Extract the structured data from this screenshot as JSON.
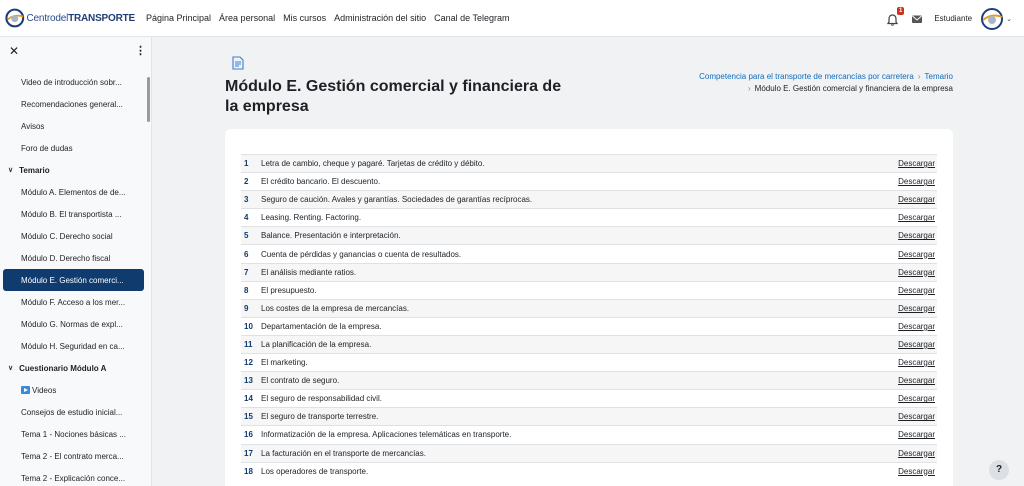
{
  "brand": {
    "text_light": "Centrodel",
    "text_bold": "TRANSPORTE"
  },
  "nav": {
    "links": [
      "Página Principal",
      "Área personal",
      "Mis cursos",
      "Administración del sitio",
      "Canal de Telegram"
    ],
    "notification_count": "1",
    "user_name": "Estudiante"
  },
  "drawer": {
    "items": [
      {
        "label": "Video de introducción sobr...",
        "type": "item"
      },
      {
        "label": "Recomendaciones general...",
        "type": "item"
      },
      {
        "label": "Avisos",
        "type": "item"
      },
      {
        "label": "Foro de dudas",
        "type": "item"
      },
      {
        "label": "Temario",
        "type": "section"
      },
      {
        "label": "Módulo A. Elementos de de...",
        "type": "item"
      },
      {
        "label": "Módulo B. El transportista ...",
        "type": "item"
      },
      {
        "label": "Módulo C. Derecho social",
        "type": "item"
      },
      {
        "label": "Módulo D. Derecho fiscal",
        "type": "item"
      },
      {
        "label": "Módulo E. Gestión comerci...",
        "type": "active"
      },
      {
        "label": "Módulo F. Acceso a los mer...",
        "type": "item"
      },
      {
        "label": "Módulo G. Normas de expl...",
        "type": "item"
      },
      {
        "label": "Módulo H. Seguridad en ca...",
        "type": "item"
      },
      {
        "label": "Cuestionario Módulo A",
        "type": "section"
      },
      {
        "label": "Videos",
        "type": "video"
      },
      {
        "label": "Consejos de estudio inicial...",
        "type": "item"
      },
      {
        "label": "Tema 1 - Nociones básicas ...",
        "type": "item"
      },
      {
        "label": "Tema 2 - El contrato merca...",
        "type": "item"
      },
      {
        "label": "Tema 2 - Explicación conce...",
        "type": "item"
      }
    ]
  },
  "page": {
    "title": "Módulo E. Gestión comercial y financiera de la empresa",
    "breadcrumb": {
      "course": "Competencia para el transporte de mercancías por carretera",
      "section": "Temario",
      "current": "Módulo E. Gestión comercial y financiera de la empresa"
    }
  },
  "download_label": "Descargar",
  "topics": [
    {
      "n": "1",
      "title": "Letra de cambio, cheque y pagaré. Tarjetas de crédito y débito."
    },
    {
      "n": "2",
      "title": "El crédito bancario. El descuento."
    },
    {
      "n": "3",
      "title": "Seguro de caución. Avales y garantías. Sociedades de garantías recíprocas."
    },
    {
      "n": "4",
      "title": "Leasing. Renting. Factoring."
    },
    {
      "n": "5",
      "title": "Balance. Presentación e interpretación."
    },
    {
      "n": "6",
      "title": "Cuenta de pérdidas y ganancias o cuenta de resultados."
    },
    {
      "n": "7",
      "title": "El análisis mediante ratios."
    },
    {
      "n": "8",
      "title": "El presupuesto."
    },
    {
      "n": "9",
      "title": "Los costes de la empresa de mercancías."
    },
    {
      "n": "10",
      "title": "Departamentación de la empresa."
    },
    {
      "n": "11",
      "title": "La planificación de la empresa."
    },
    {
      "n": "12",
      "title": "El marketing."
    },
    {
      "n": "13",
      "title": "El contrato de seguro."
    },
    {
      "n": "14",
      "title": "El seguro de responsabilidad civil."
    },
    {
      "n": "15",
      "title": "El seguro de transporte terrestre."
    },
    {
      "n": "16",
      "title": "Informatización de la empresa. Aplicaciones telemáticas en transporte."
    },
    {
      "n": "17",
      "title": "La facturación en el transporte de mercancías."
    },
    {
      "n": "18",
      "title": "Los operadores de transporte."
    }
  ],
  "help_label": "?",
  "icons": {
    "close": "close-icon",
    "menu": "kebab-menu-icon",
    "bell": "bell-icon",
    "message": "envelope-icon",
    "doc": "document-icon"
  }
}
